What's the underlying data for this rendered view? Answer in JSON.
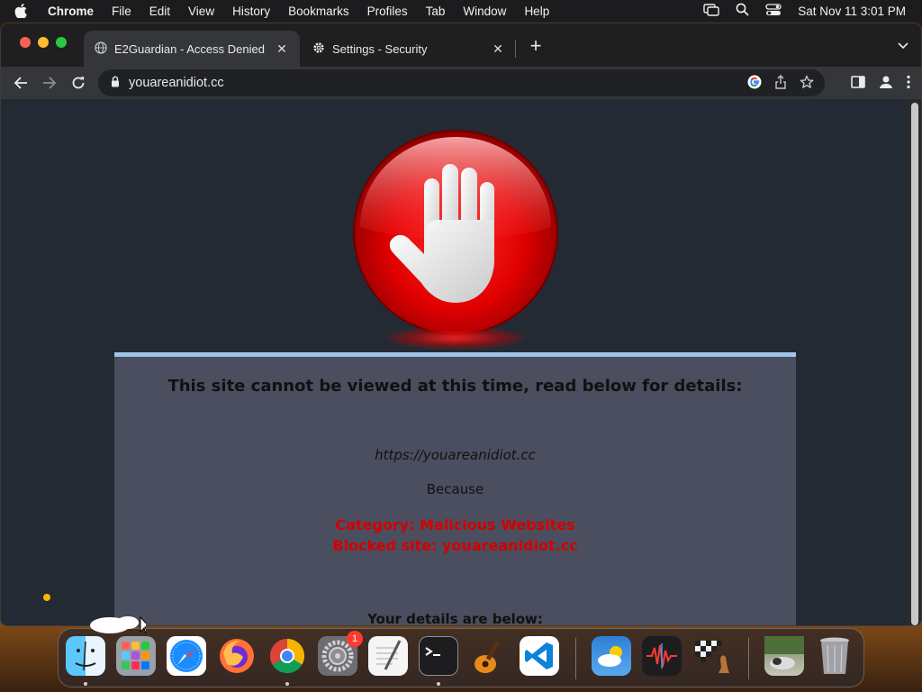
{
  "menubar": {
    "app_name": "Chrome",
    "items": [
      "File",
      "Edit",
      "View",
      "History",
      "Bookmarks",
      "Profiles",
      "Tab",
      "Window",
      "Help"
    ],
    "clock": "Sat Nov 11  3:01 PM"
  },
  "tabs": [
    {
      "title": "E2Guardian - Access Denied",
      "icon": "globe-icon",
      "active": true
    },
    {
      "title": "Settings - Security",
      "icon": "gear-icon",
      "active": false
    }
  ],
  "omnibox": {
    "url": "youareanidiot.cc"
  },
  "page": {
    "heading": "This site cannot be viewed at this time, read below for details:",
    "blocked_url": "https://youareanidiot.cc",
    "because": "Because",
    "reason_category": "Category: Malicious Websites",
    "reason_site": "Blocked site: youareanidiot.cc",
    "details_heading": "Your details are below:"
  },
  "dock": {
    "items": [
      "Finder",
      "Launchpad",
      "Safari",
      "Firefox",
      "Chrome",
      "System Settings",
      "TextEdit",
      "Terminal",
      "GarageBand",
      "Visual Studio Code",
      "Weather",
      "Voice Memos",
      "Chess",
      "Photo",
      "Trash"
    ],
    "system_settings_badge": "1"
  },
  "colors": {
    "panel_bg": "#4a4e5e",
    "panel_border": "#9fc5e8",
    "reason_red": "#d40000",
    "page_bg": "#242a33"
  }
}
